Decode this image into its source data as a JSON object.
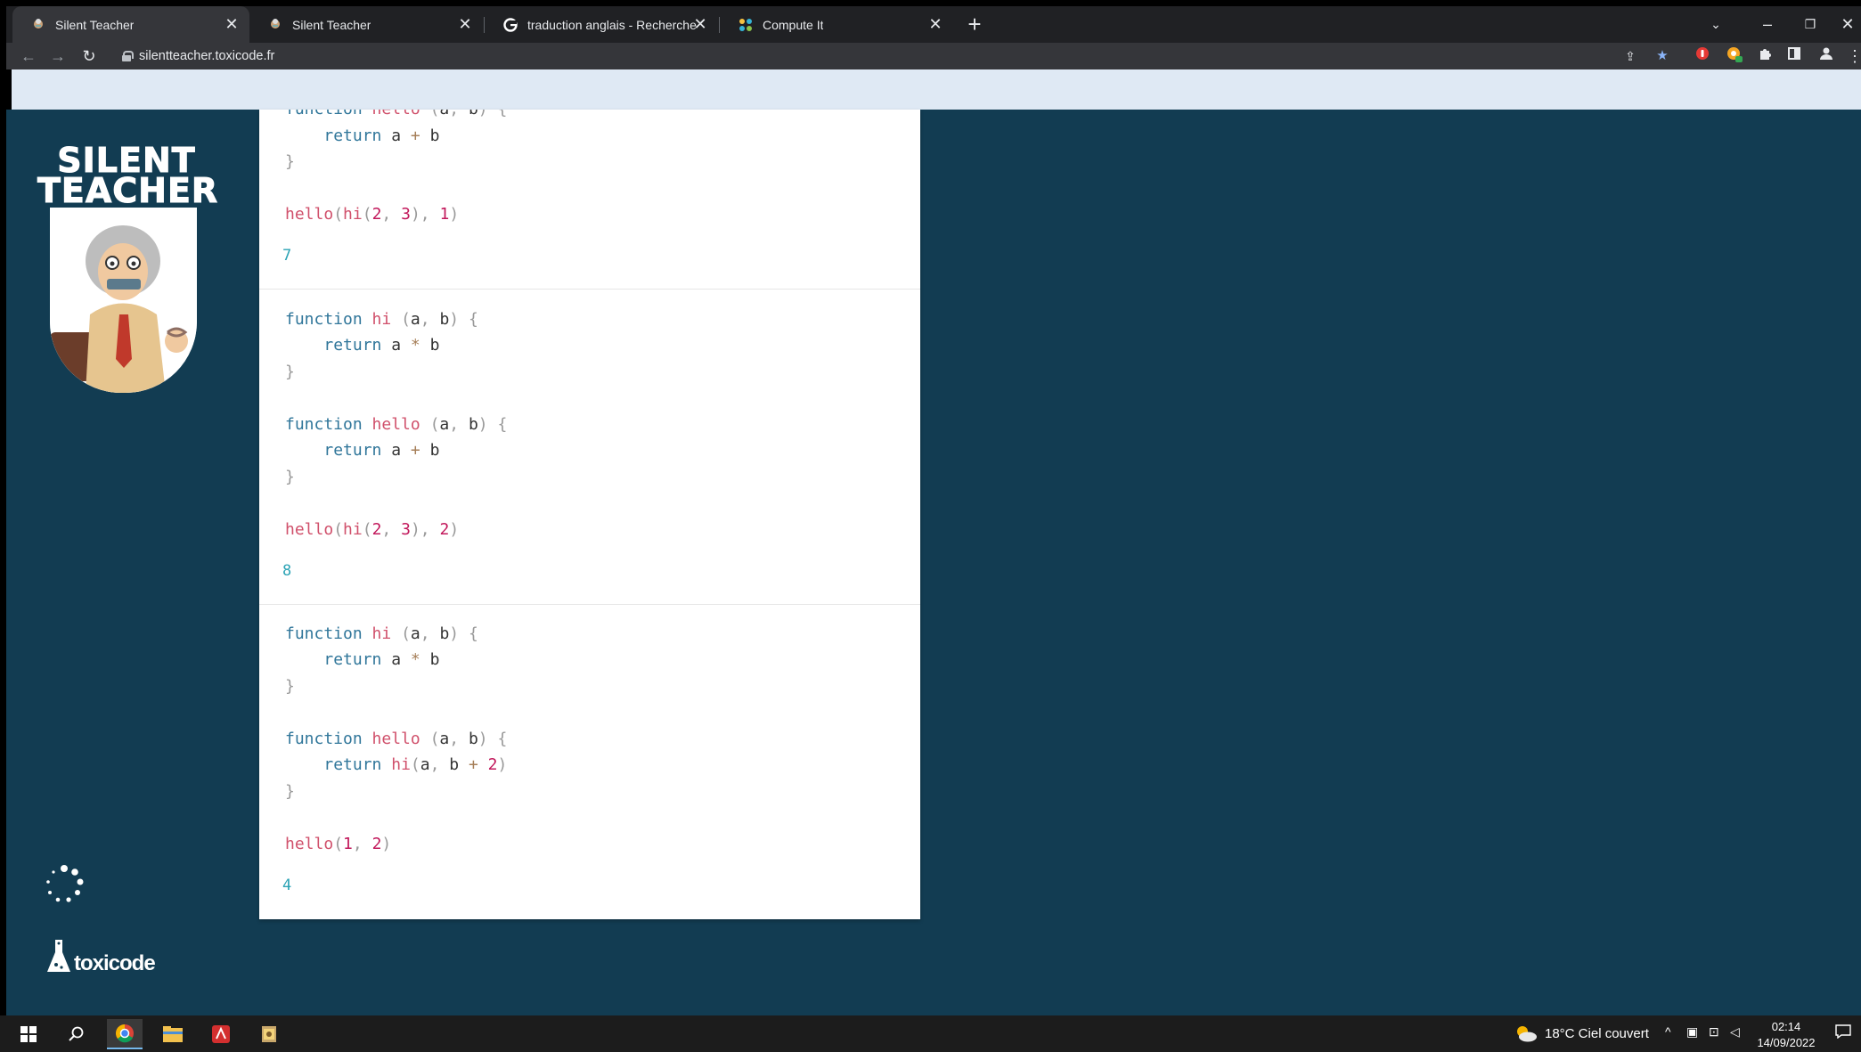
{
  "browser": {
    "tabs": [
      {
        "title": "Silent Teacher",
        "icon": "silent-teacher-favicon",
        "active": true
      },
      {
        "title": "Silent Teacher",
        "icon": "silent-teacher-favicon",
        "active": false
      },
      {
        "title": "traduction anglais - Recherche G",
        "icon": "google-favicon",
        "active": false
      },
      {
        "title": "Compute It",
        "icon": "compute-it-favicon",
        "active": false
      }
    ],
    "url": "silentteacher.toxicode.fr"
  },
  "sidebar": {
    "logo_title_line1": "SILENT",
    "logo_title_line2": "TEACHER",
    "footer_brand": "toxicode"
  },
  "exercises": [
    {
      "lines": [
        "function hello (a, b) {",
        "    return a + b",
        "}",
        "",
        "hello(hi(2, 3), 1)"
      ],
      "answer": "7"
    },
    {
      "lines": [
        "function hi (a, b) {",
        "    return a * b",
        "}",
        "",
        "function hello (a, b) {",
        "    return a + b",
        "}",
        "",
        "hello(hi(2, 3), 2)"
      ],
      "answer": "8"
    },
    {
      "lines": [
        "function hi (a, b) {",
        "    return a * b",
        "}",
        "",
        "function hello (a, b) {",
        "    return hi(a, b + 2)",
        "}",
        "",
        "hello(1, 2)"
      ],
      "answer": "4"
    }
  ],
  "taskbar": {
    "weather": "18°C  Ciel couvert",
    "time": "02:14",
    "date": "14/09/2022"
  }
}
